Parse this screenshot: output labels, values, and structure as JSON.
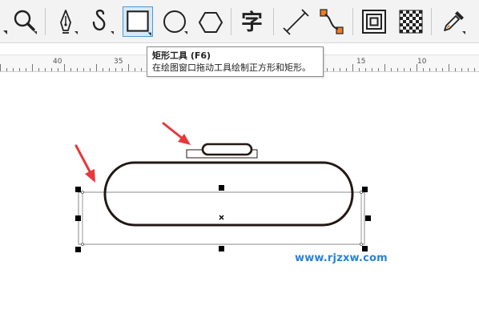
{
  "toolbar": {
    "tools": [
      {
        "name": "zoom-tool",
        "icon": "magnifier-icon"
      },
      {
        "name": "pen-tool",
        "icon": "pen-nib-icon"
      },
      {
        "name": "curve-tool",
        "icon": "hook-curve-icon"
      },
      {
        "name": "rectangle-tool",
        "icon": "rectangle-icon",
        "active": true
      },
      {
        "name": "ellipse-tool",
        "icon": "ellipse-icon"
      },
      {
        "name": "polygon-tool",
        "icon": "hexagon-icon"
      },
      {
        "name": "text-tool",
        "icon": "text-glyph-icon",
        "glyph": "字"
      },
      {
        "name": "dimension-tool",
        "icon": "parallel-dimension-icon"
      },
      {
        "name": "connector-tool",
        "icon": "connector-icon"
      },
      {
        "name": "contour-tool",
        "icon": "contour-icon"
      },
      {
        "name": "transparency-tool",
        "icon": "checkerboard-icon"
      },
      {
        "name": "eyedropper-tool",
        "icon": "eyedropper-icon"
      }
    ],
    "active_color": "#4a9ad4",
    "accent_color": "#ee7d22"
  },
  "ruler": {
    "labels": [
      "40",
      "35",
      "15",
      "10"
    ]
  },
  "tooltip": {
    "title": "矩形工具 (F6)",
    "description": "在绘图窗口拖动工具绘制正方形和矩形。"
  },
  "canvas": {
    "annotation_arrow_color": "#e8383d",
    "watermark": "www.rjzxw.com",
    "watermark_color": "#2a82d8"
  }
}
